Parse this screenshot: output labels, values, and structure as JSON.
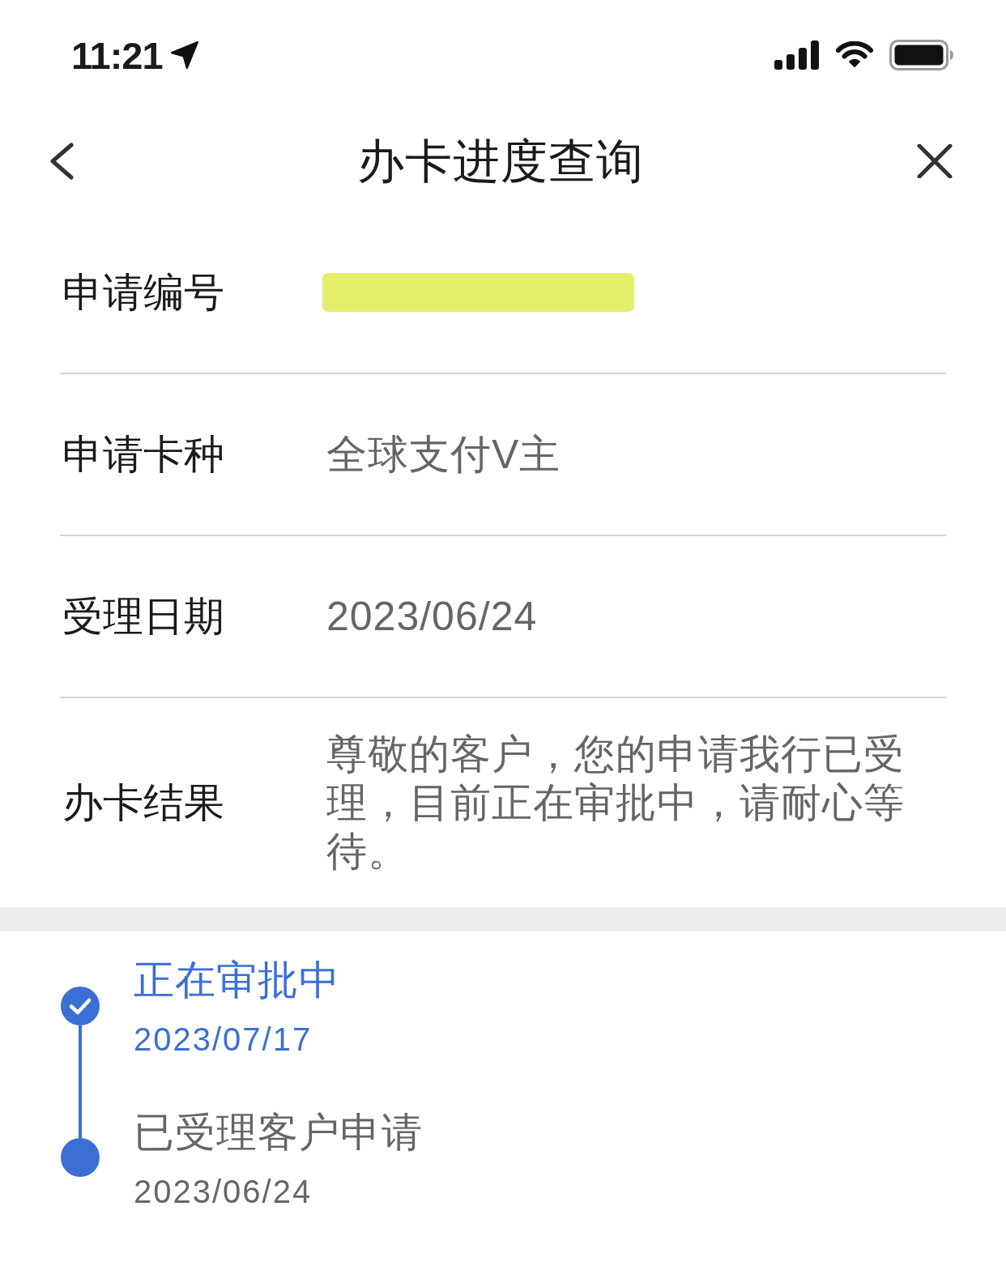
{
  "status_bar": {
    "time": "11:21"
  },
  "nav": {
    "title": "办卡进度查询"
  },
  "rows": [
    {
      "label": "申请编号",
      "redacted": true
    },
    {
      "label": "申请卡种",
      "value": "全球支付V主"
    },
    {
      "label": "受理日期",
      "value": "2023/06/24"
    },
    {
      "label": "办卡结果",
      "value": "尊敬的客户，您的申请我行已受理，目前正在审批中，请耐心等待。"
    }
  ],
  "timeline": [
    {
      "title": "正在审批中",
      "date": "2023/07/17",
      "current": true
    },
    {
      "title": "已受理客户申请",
      "date": "2023/06/24",
      "current": false
    }
  ]
}
